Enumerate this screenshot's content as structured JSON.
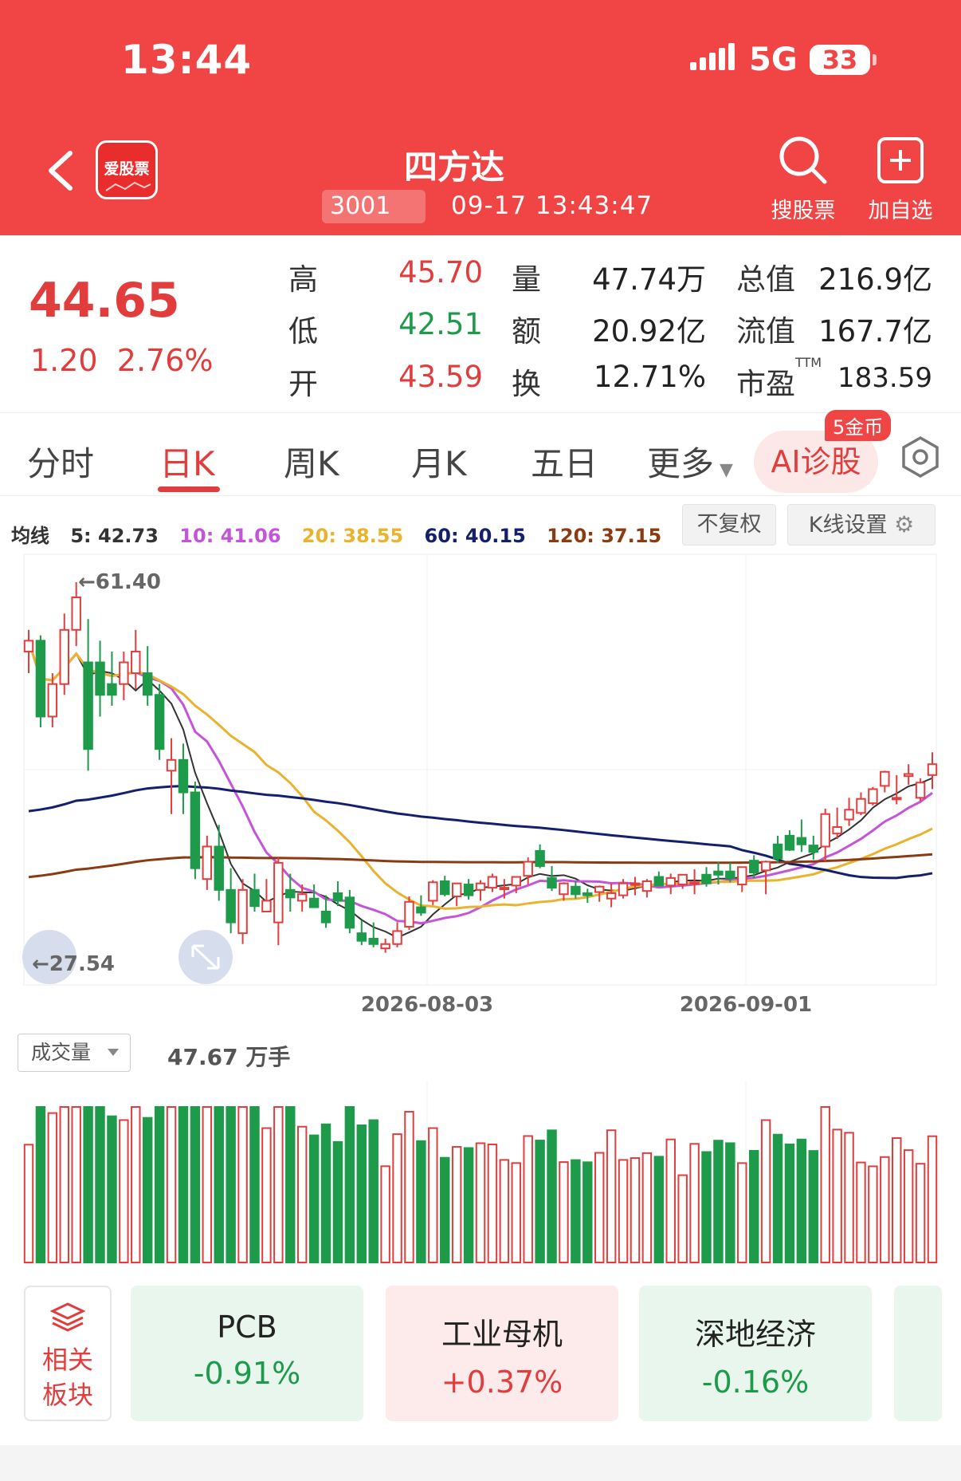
{
  "status": {
    "time": "13:44",
    "network": "5G",
    "battery": "33"
  },
  "header": {
    "logo_text": "爱股票",
    "stock_name": "四方达",
    "code": "3001",
    "timestamp": "09-17 13:43:47",
    "search_label": "搜股票",
    "add_label": "加自选"
  },
  "quote": {
    "price": "44.65",
    "change": "1.20",
    "change_pct": "2.76%",
    "high_label": "高",
    "high": "45.70",
    "low_label": "低",
    "low": "42.51",
    "open_label": "开",
    "open": "43.59",
    "vol_label": "量",
    "vol": "47.74万",
    "amt_label": "额",
    "amt": "20.92亿",
    "turn_label": "换",
    "turn": "12.71%",
    "cap_label": "总值",
    "cap": "216.9亿",
    "float_label": "流值",
    "float": "167.7亿",
    "pe_label": "市盈",
    "pe_sup": "TTM",
    "pe": "183.59"
  },
  "tabs": [
    {
      "label": "分时"
    },
    {
      "label": "日K"
    },
    {
      "label": "周K"
    },
    {
      "label": "月K"
    },
    {
      "label": "五日"
    },
    {
      "label": "更多"
    }
  ],
  "ai": {
    "label": "AI诊股",
    "badge": "5金币"
  },
  "ma": {
    "title": "均线",
    "ma5": "5: 42.73",
    "ma10": "10: 41.06",
    "ma20": "20: 38.55",
    "ma60": "60: 40.15",
    "ma120": "120: 37.15"
  },
  "buttons": {
    "adjust": "不复权",
    "kline_settings": "K线设置"
  },
  "chart": {
    "max_label": "←61.40",
    "min_label": "←27.54",
    "date1": "2026-08-03",
    "date2": "2026-09-01"
  },
  "volume": {
    "selector": "成交量",
    "value": "47.67 万手"
  },
  "sectors": {
    "related_line1": "相关",
    "related_line2": "板块",
    "items": [
      {
        "name": "PCB",
        "pct": "-0.91%"
      },
      {
        "name": "工业母机",
        "pct": "+0.37%"
      },
      {
        "name": "深地经济",
        "pct": "-0.16%"
      }
    ]
  },
  "colors": {
    "up": "#e13d3d",
    "down": "#1e9b4a",
    "brand": "#f14545",
    "ma5": "#333333",
    "ma10": "#c455d8",
    "ma20": "#e9b32e",
    "ma60": "#14206e",
    "ma120": "#8a3b12"
  },
  "chart_data": {
    "type": "candlestick",
    "ylim": [
      27.54,
      61.4
    ],
    "x_ticks": [
      "2026-08-03",
      "2026-09-01"
    ],
    "candles": [
      [
        55,
        57,
        53,
        56
      ],
      [
        56,
        56.5,
        48,
        49
      ],
      [
        49,
        53,
        48,
        52
      ],
      [
        52,
        58.5,
        51,
        57
      ],
      [
        57,
        61.4,
        55.5,
        60
      ],
      [
        54,
        58,
        44,
        46
      ],
      [
        54,
        56,
        49,
        51
      ],
      [
        52,
        55,
        50,
        51
      ],
      [
        52,
        55,
        50.5,
        54
      ],
      [
        53,
        57,
        51.5,
        55
      ],
      [
        53,
        55.5,
        50,
        51
      ],
      [
        51,
        52,
        45,
        46
      ],
      [
        44,
        47,
        40,
        45
      ],
      [
        45,
        46.5,
        40,
        42
      ],
      [
        42,
        43,
        34,
        35
      ],
      [
        34,
        38,
        33,
        37
      ],
      [
        37,
        39,
        32,
        33
      ],
      [
        33,
        35,
        29,
        30
      ],
      [
        29,
        34,
        28,
        33
      ],
      [
        33,
        34.5,
        31,
        31.5
      ],
      [
        31,
        34,
        31,
        32
      ],
      [
        30,
        36,
        27.9,
        35.5
      ],
      [
        33,
        34.5,
        31,
        32.3
      ],
      [
        32,
        33.5,
        31,
        32.6
      ],
      [
        32.2,
        33.5,
        31.5,
        31.4
      ],
      [
        31,
        32.5,
        29.5,
        30
      ],
      [
        32.7,
        33.8,
        31.5,
        32
      ],
      [
        32.3,
        33,
        29,
        29.5
      ],
      [
        29,
        30.2,
        27.9,
        28.3
      ],
      [
        28.5,
        30,
        27.7,
        28
      ],
      [
        27.6,
        28.5,
        27.2,
        28
      ],
      [
        28,
        30,
        27.7,
        29.2
      ],
      [
        29.6,
        32.4,
        29.3,
        31.9
      ],
      [
        31.4,
        32.5,
        30.6,
        30.9
      ],
      [
        32,
        33.9,
        31.6,
        33.7
      ],
      [
        33.8,
        34.3,
        32.4,
        32.6
      ],
      [
        32.4,
        33.6,
        31.5,
        33.6
      ],
      [
        33.5,
        34,
        32.1,
        32.5
      ],
      [
        33,
        33.9,
        32,
        33.6
      ],
      [
        33.2,
        34.5,
        32.8,
        34.2
      ],
      [
        33.1,
        34,
        32.2,
        33.2
      ],
      [
        33.4,
        34.2,
        32.7,
        34.2
      ],
      [
        34.3,
        36,
        33.5,
        35.6
      ],
      [
        36.6,
        37.2,
        35,
        35.2
      ],
      [
        34.1,
        35.2,
        32.9,
        33.2
      ],
      [
        32.6,
        33.7,
        32,
        33.6
      ],
      [
        33.3,
        33.8,
        32.2,
        32.6
      ],
      [
        32.7,
        33.1,
        31.8,
        32.5
      ],
      [
        32.8,
        33.4,
        31.9,
        33.3
      ],
      [
        32.2,
        33.6,
        31.4,
        32.7
      ],
      [
        32.5,
        34,
        32.2,
        33.6
      ],
      [
        33.5,
        34.2,
        32.5,
        33.6
      ],
      [
        32.9,
        34,
        32.3,
        33.8
      ],
      [
        34.2,
        34.7,
        33.3,
        33.4
      ],
      [
        33.4,
        34.5,
        32.6,
        34.1
      ],
      [
        33.5,
        34.3,
        33.1,
        34.4
      ],
      [
        33.6,
        34.9,
        32.6,
        33.7
      ],
      [
        34.4,
        35.1,
        33.3,
        33.6
      ],
      [
        34.7,
        35.6,
        33.5,
        34.4
      ],
      [
        34.7,
        35.5,
        33.7,
        34.1
      ],
      [
        33.5,
        34.5,
        32.8,
        35.1
      ],
      [
        35.7,
        36.2,
        34.1,
        34.6
      ],
      [
        34.8,
        35.7,
        32.6,
        35.6
      ],
      [
        37.2,
        38,
        35.5,
        35.9
      ],
      [
        38,
        38.5,
        36.6,
        36.7
      ],
      [
        37.8,
        39.5,
        36.5,
        37.2
      ],
      [
        37.1,
        38,
        35.8,
        36.5
      ],
      [
        37,
        40.5,
        35.6,
        40
      ],
      [
        38.2,
        40.6,
        37.7,
        38.8
      ],
      [
        39.5,
        41.5,
        38.9,
        40.4
      ],
      [
        40.1,
        42,
        39.9,
        41.4
      ],
      [
        41,
        42.5,
        40.8,
        42.3
      ],
      [
        42.6,
        44,
        42,
        43.9
      ],
      [
        41.4,
        43.6,
        40.9,
        41.5
      ],
      [
        43.5,
        44.6,
        42.7,
        43.7
      ],
      [
        41.5,
        43.3,
        41.2,
        42.9
      ],
      [
        43.6,
        45.7,
        42.3,
        44.6
      ]
    ],
    "volume_max": 100
  }
}
